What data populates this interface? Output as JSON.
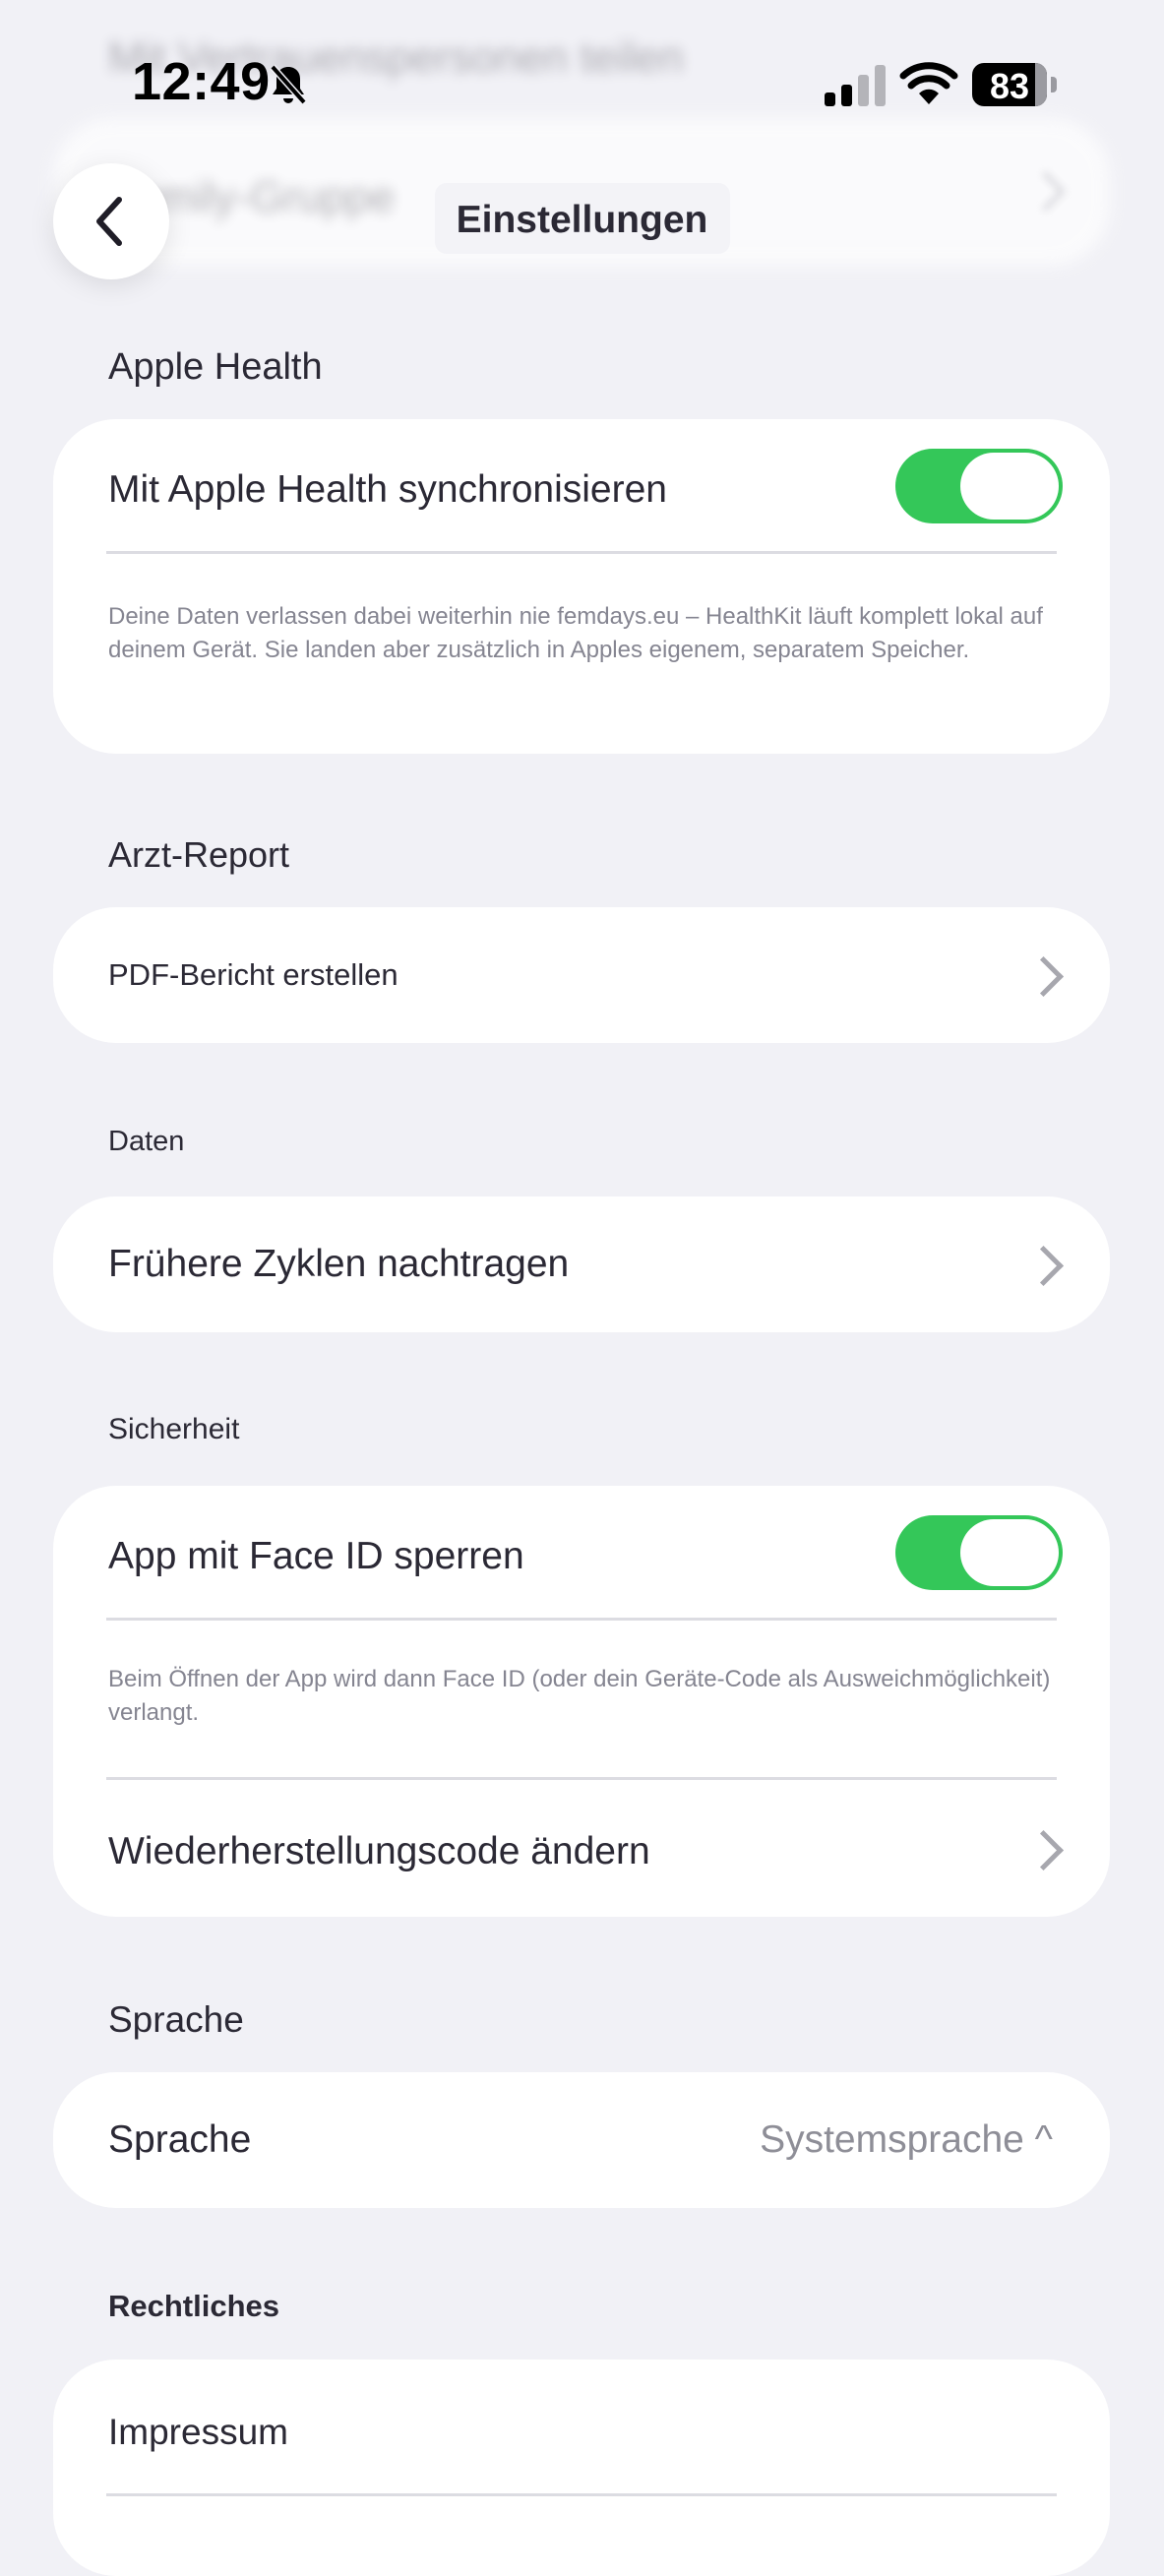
{
  "background_ghost": {
    "line1": "Mit Vertrauenspersonen teilen",
    "line2": "Family-Gruppe"
  },
  "status_bar": {
    "time": "12:49",
    "battery_percent": "83",
    "icons": [
      "bell-slash-icon",
      "cellular-signal-icon",
      "wifi-icon",
      "battery-icon"
    ]
  },
  "nav": {
    "title": "Einstellungen",
    "back_icon": "chevron-left-icon"
  },
  "sections": {
    "apple_health": {
      "label": "Apple Health",
      "sync_label": "Mit Apple Health synchronisieren",
      "sync_enabled": true,
      "note": "Deine Daten verlassen dabei weiterhin nie femdays.eu – HealthKit läuft komplett lokal auf deinem Gerät. Sie landen aber zusätzlich in Apples eigenem, separatem Speicher."
    },
    "doctor_report": {
      "label": "Arzt-Report",
      "pdf_label": "PDF-Bericht erstellen"
    },
    "data": {
      "label": "Daten",
      "past_cycles_label": "Frühere Zyklen nachtragen"
    },
    "security": {
      "label": "Sicherheit",
      "faceid_label": "App mit Face ID sperren",
      "faceid_enabled": true,
      "note": "Beim Öffnen der App wird dann Face ID (oder dein Geräte-Code als Ausweichmöglichkeit) verlangt.",
      "recovery_label": "Wiederherstellungscode ändern"
    },
    "language": {
      "label": "Sprache",
      "row_label": "Sprache",
      "value": "Systemsprache ^"
    },
    "legal": {
      "label": "Rechtliches",
      "imprint_label": "Impressum"
    }
  },
  "colors": {
    "background": "#f1f1f6",
    "card": "#ffffff",
    "toggle_on": "#34c759",
    "secondary_text": "#858591"
  }
}
